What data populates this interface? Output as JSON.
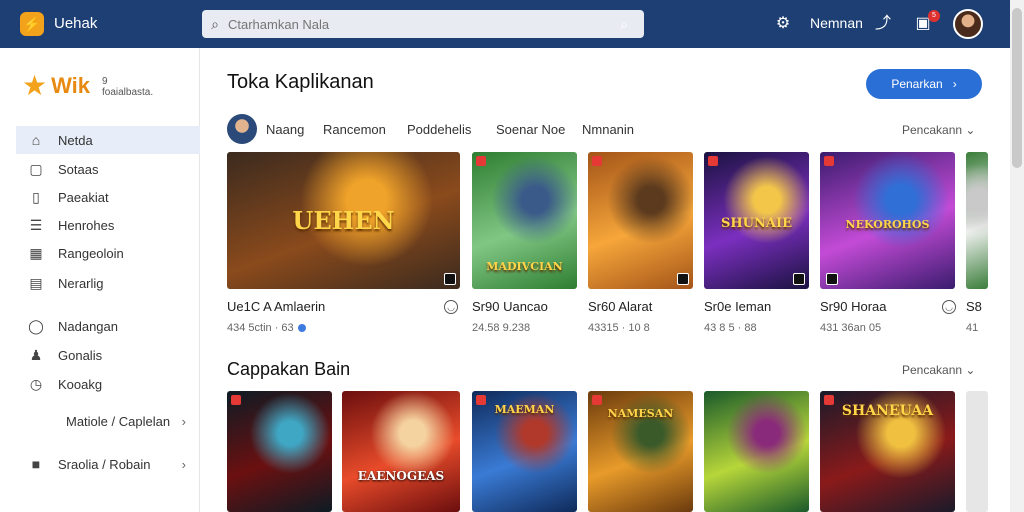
{
  "app": {
    "logo_glyph": "⚡",
    "title": "Uehak"
  },
  "search": {
    "placeholder": "Ctarhamkan Nala"
  },
  "topbar": {
    "user_label": "Nemnan",
    "badge_count": "5"
  },
  "sidebar": {
    "brand_name": "Wik",
    "brand_sub": "9\nfoaialbasta.",
    "items": [
      {
        "label": "Netda",
        "icon": "home-icon",
        "active": true
      },
      {
        "label": "Sotaas",
        "icon": "square-icon",
        "active": false
      },
      {
        "label": "Paeakiat",
        "icon": "bookmark-icon",
        "active": false
      },
      {
        "label": "Henrohes",
        "icon": "list-icon",
        "active": false
      },
      {
        "label": "Rangeoloin",
        "icon": "grid-icon",
        "active": false
      },
      {
        "label": "Nerarlig",
        "icon": "folder-icon",
        "active": false
      },
      {
        "label": "Nadangan",
        "icon": "location-icon",
        "active": false
      },
      {
        "label": "Gonalis",
        "icon": "user-icon",
        "active": false
      },
      {
        "label": "Kooakg",
        "icon": "clock-icon",
        "active": false
      },
      {
        "label": "Matiole / Caplelan",
        "icon": "",
        "active": false
      },
      {
        "label": "Sraolia / Robain",
        "icon": "bag-icon",
        "active": false
      }
    ]
  },
  "main": {
    "section1": {
      "title": "Toka Kaplikanan",
      "button_label": "Penarkan",
      "chips": [
        "Naang",
        "Rancemon",
        "Poddehelis",
        "Soenar Noe",
        "Nmnanin"
      ],
      "more_label": "Pencakann",
      "cards": [
        {
          "cover": "UEHEN",
          "title": "Ue1C A Amlaerin",
          "meta": "434 5ctin · 63",
          "colors": [
            "#3b2a1e",
            "#8a4a1c",
            "#f0a32a"
          ]
        },
        {
          "cover": "MADIVCIAN",
          "title": "Sr90 Uancao",
          "meta": "24.58 9.238",
          "colors": [
            "#2e7d32",
            "#81c784",
            "#3a5a8a"
          ]
        },
        {
          "cover": "",
          "title": "Sr60 Alarat",
          "meta": "43315 · 10 8",
          "colors": [
            "#a35418",
            "#f6a63a",
            "#5b3a1e"
          ]
        },
        {
          "cover": "SHUNAIE",
          "title": "Sr0e Ieman",
          "meta": "43 8 5 · 88",
          "colors": [
            "#1a1240",
            "#7b2fbf",
            "#f3c64a"
          ]
        },
        {
          "cover": "NEKOROHOS",
          "title": "Sr90 Horaa",
          "meta": "431 36an 05",
          "colors": [
            "#3a1c6e",
            "#c34bd6",
            "#2f6fd6"
          ]
        },
        {
          "cover": "",
          "title": "S8",
          "meta": "41",
          "colors": [
            "#3a7d3a",
            "#f2f2f2",
            "#c9c9c9"
          ]
        }
      ]
    },
    "section2": {
      "title": "Cappakan Bain",
      "more_label": "Pencakann",
      "cards": [
        {
          "cover": "",
          "colors": [
            "#0d1b24",
            "#6b1010",
            "#3fa7c4"
          ]
        },
        {
          "cover": "EAENOGEAS",
          "colors": [
            "#6b0e0e",
            "#e84b2a",
            "#f5d3a0"
          ]
        },
        {
          "cover": "MAEMAN",
          "colors": [
            "#0f2a5a",
            "#3a7bd5",
            "#b0392b"
          ]
        },
        {
          "cover": "NAMESAN",
          "colors": [
            "#6b3a0d",
            "#e89b2a",
            "#3a5a2a"
          ]
        },
        {
          "cover": "",
          "colors": [
            "#1a5a2a",
            "#b7d63a",
            "#8a2a7a"
          ]
        },
        {
          "cover": "SHANEUAA",
          "colors": [
            "#1a1a2a",
            "#8a1a1a",
            "#f0c040"
          ]
        }
      ]
    }
  }
}
